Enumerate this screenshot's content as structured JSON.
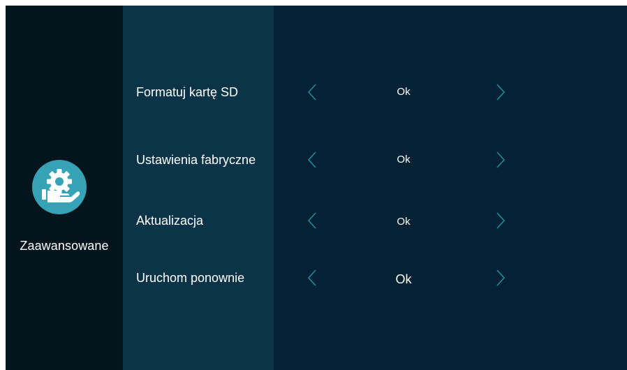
{
  "sidebar": {
    "icon": "settings-gear-hand-icon",
    "label": "Zaawansowane",
    "accent_color": "#35a3b5"
  },
  "settings": [
    {
      "label": "Formatuj kartę SD",
      "value": "Ok",
      "prev_icon": "chevron-left-icon",
      "next_icon": "chevron-right-icon"
    },
    {
      "label": "Ustawienia fabryczne",
      "value": "Ok",
      "prev_icon": "chevron-left-icon",
      "next_icon": "chevron-right-icon"
    },
    {
      "label": "Aktualizacja",
      "value": "Ok",
      "prev_icon": "chevron-left-icon",
      "next_icon": "chevron-right-icon"
    },
    {
      "label": "Uruchom ponownie",
      "value": "Ok",
      "prev_icon": "chevron-left-icon",
      "next_icon": "chevron-right-icon"
    }
  ],
  "colors": {
    "background": "#052234",
    "sidebar": "#03141d",
    "label_column": "#0b3448",
    "arrow": "#1d8fa3",
    "text": "#ffffff"
  }
}
